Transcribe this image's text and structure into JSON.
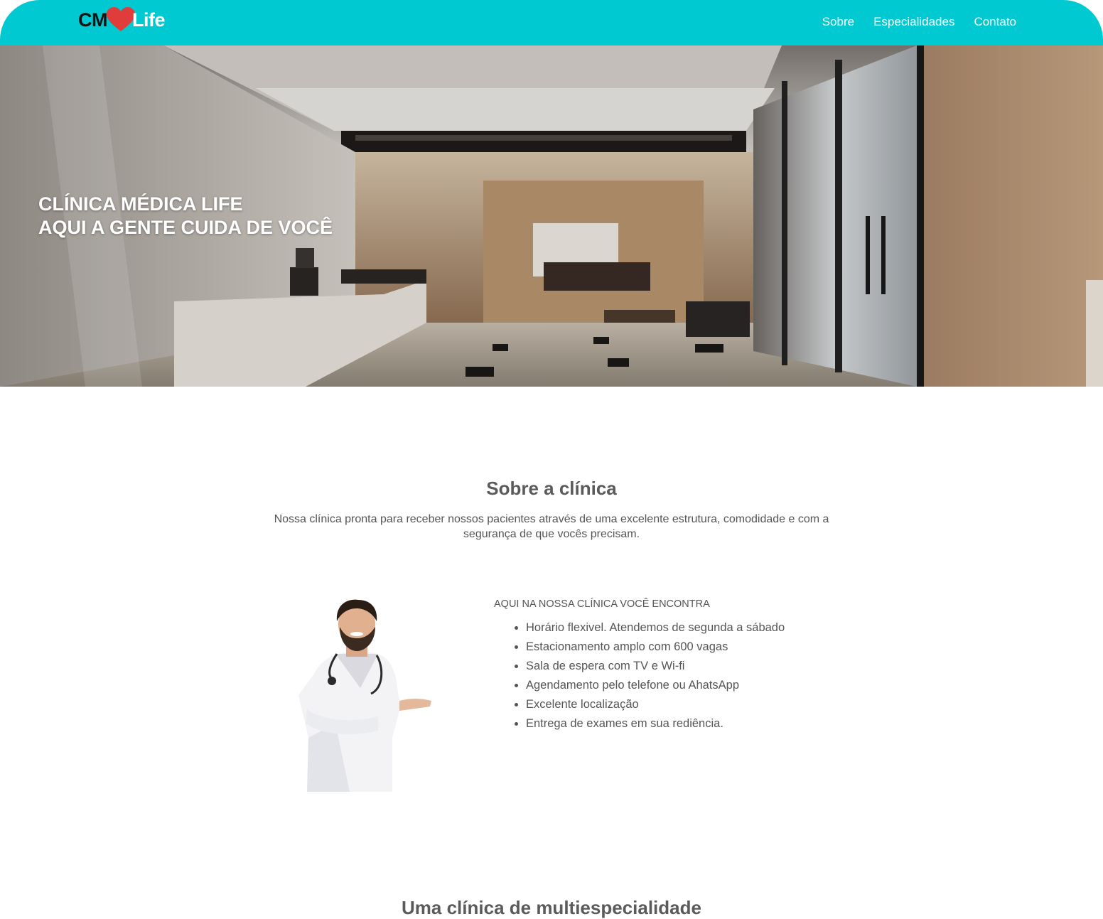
{
  "header": {
    "logo_left": "CM",
    "logo_right": "Life",
    "nav": [
      "Sobre",
      "Especialidades",
      "Contato"
    ],
    "bg_color": "#00c9d1"
  },
  "hero": {
    "line1": "CLÍNICA MÉDICA LIFE",
    "line2": "AQUI A GENTE CUIDA DE VOCÊ"
  },
  "about": {
    "title": "Sobre a clínica",
    "description": "Nossa clínica pronta para receber nossos pacientes através de uma excelente estrutura, comodidade e com a segurança de que vocês precisam.",
    "features_heading": "AQUI NA NOSSA CLÍNICA VOCÊ ENCONTRA",
    "features": [
      "Horário flexivel. Atendemos de segunda a sábado",
      "Estacionamento amplo com 600 vagas",
      "Sala de espera com TV e Wi-fi",
      "Agendamento pelo telefone ou AhatsApp",
      "Excelente localização",
      "Entrega de exames em sua rediência."
    ]
  },
  "section2": {
    "title": "Uma clínica de multiespecialidade"
  }
}
